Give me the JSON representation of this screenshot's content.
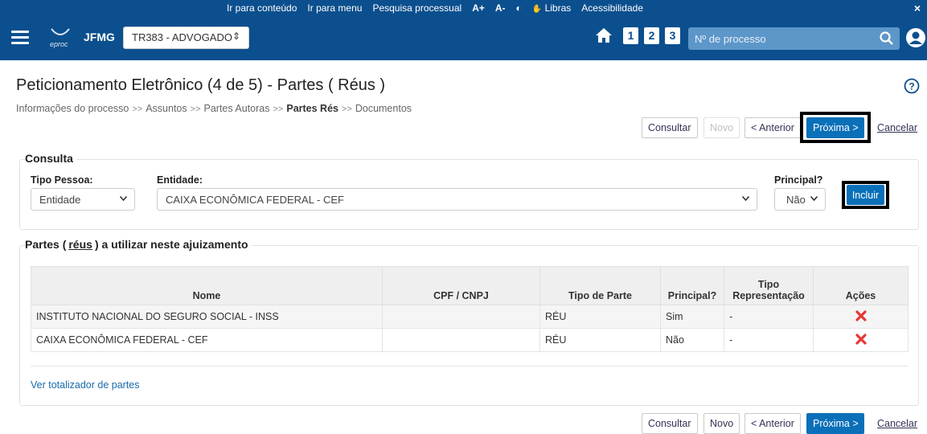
{
  "topbar": {
    "links": [
      "Ir para conteúdo",
      "Ir para menu",
      "Pesquisa processual",
      "A+",
      "A-",
      "◐",
      "Libras",
      "Acessibilidade"
    ],
    "close": "×"
  },
  "navbar": {
    "logo_text": "eproc",
    "org": "JFMG",
    "profile": "TR383 - ADVOGADO",
    "shortcuts": [
      "1",
      "2",
      "3"
    ],
    "process_placeholder": "Nº de processo"
  },
  "page": {
    "title": "Peticionamento Eletrônico (4 de 5) - Partes ( Réus )",
    "breadcrumb": [
      "Informações do processo",
      "Assuntos",
      "Partes Autoras",
      "Partes Rés",
      "Documentos"
    ],
    "breadcrumb_sep": ">>"
  },
  "buttons": {
    "consultar": "Consultar",
    "novo": "Novo",
    "anterior": "< Anterior",
    "proxima": "Próxima >",
    "cancelar": "Cancelar",
    "incluir": "Incluir"
  },
  "consulta": {
    "legend": "Consulta",
    "tipo_pessoa_label": "Tipo Pessoa:",
    "tipo_pessoa_value": "Entidade",
    "entidade_label": "Entidade:",
    "entidade_value": "CAIXA ECONÔMICA FEDERAL - CEF",
    "principal_label": "Principal?",
    "principal_value": "Não"
  },
  "partes": {
    "legend_prefix": "Partes (",
    "legend_reus": "réus",
    "legend_suffix": ") a utilizar neste ajuizamento",
    "columns": [
      "Nome",
      "CPF / CNPJ",
      "Tipo de Parte",
      "Principal?",
      "Tipo Representação",
      "Ações"
    ],
    "rows": [
      {
        "nome": "INSTITUTO NACIONAL DO SEGURO SOCIAL - INSS",
        "cpf": "",
        "tipo": "RÉU",
        "principal": "Sim",
        "representacao": "-"
      },
      {
        "nome": "CAIXA ECONÔMICA FEDERAL - CEF",
        "cpf": "",
        "tipo": "RÉU",
        "principal": "Não",
        "representacao": "-"
      }
    ],
    "totalizador": "Ver totalizador de partes"
  },
  "colors": {
    "navbar": "#0b4f8e",
    "primary_button": "#0a70b9",
    "delete": "#e53935"
  },
  "icons": [
    "menu-icon",
    "home-icon",
    "search-icon",
    "user-icon",
    "help-icon",
    "delete-icon",
    "chevron-down-icon",
    "libras-icon",
    "contrast-icon"
  ]
}
